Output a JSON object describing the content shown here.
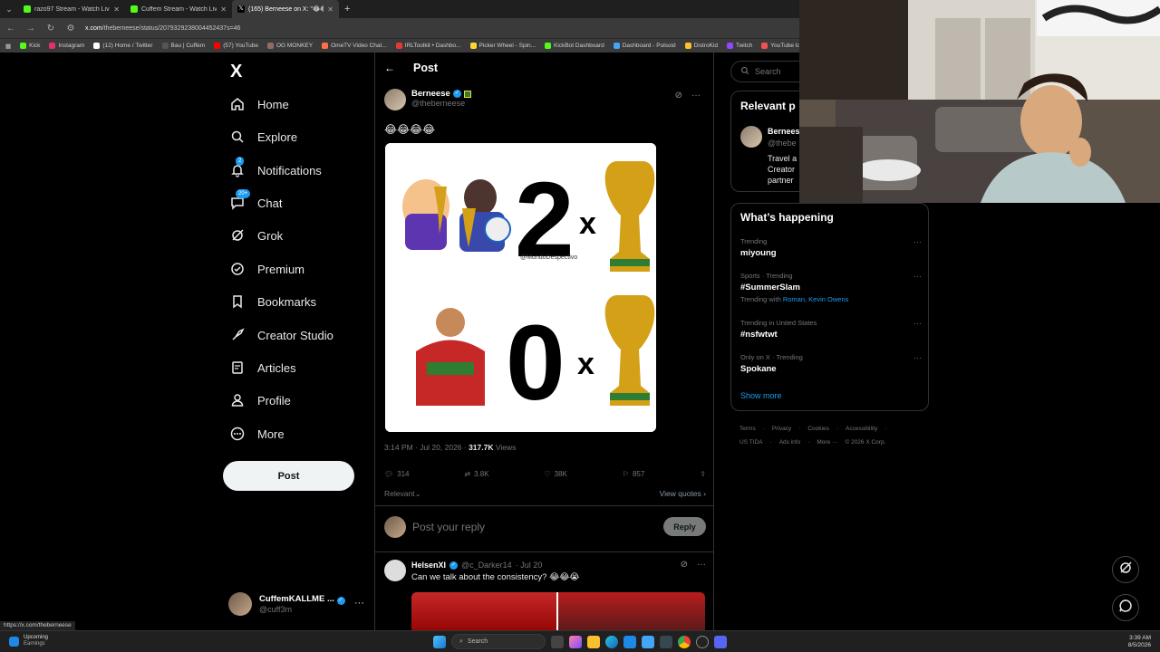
{
  "browser": {
    "tabs": [
      {
        "title": "razo97 Stream - Watch Live on",
        "color": "#53fc18",
        "active": false
      },
      {
        "title": "Cuffem Stream - Watch Live on",
        "color": "#53fc18",
        "active": false
      },
      {
        "title": "(165) Berneese on X: \"😂😂😂",
        "color": "#ffffff",
        "active": true
      }
    ],
    "new_tab": "+",
    "url_domain": "x.com",
    "url_path": "/theberneese/status/2079329238004452437s=46",
    "bookmarks": [
      "Kick",
      "Instagram",
      "(12) Home / Twitter",
      "Bau | Cuffem",
      "(57) YouTube",
      "OG MONKEY",
      "OmeTV Video Chat...",
      "IRLToolkit • Dashbo...",
      "Picker Wheel - Spin...",
      "KickBot Dashboard",
      "Dashboard - Pulsoid",
      "DistroKid",
      "Twitch",
      "YouTube to WAV D..."
    ]
  },
  "nav": {
    "logo": "X",
    "items": [
      {
        "label": "Home"
      },
      {
        "label": "Explore"
      },
      {
        "label": "Notifications",
        "badge": "2"
      },
      {
        "label": "Chat",
        "badge": "20+"
      },
      {
        "label": "Grok"
      },
      {
        "label": "Premium"
      },
      {
        "label": "Bookmarks"
      },
      {
        "label": "Creator Studio"
      },
      {
        "label": "Articles"
      },
      {
        "label": "Profile"
      },
      {
        "label": "More"
      }
    ],
    "post_button": "Post",
    "account": {
      "name": "CuffemKALLME ...",
      "handle": "@cuff3m"
    }
  },
  "post": {
    "header_title": "Post",
    "author_name": "Berneese",
    "author_handle": "@theberneese",
    "text": "😂😂😂😂",
    "image": {
      "top_count": "2",
      "bottom_count": "0",
      "x_label": "x",
      "watermark": "@MundoDespectivo"
    },
    "time": "3:14 PM · Jul 20, 2026 · ",
    "views_count": "317.7K",
    "views_label": " Views",
    "stats": {
      "replies": "314",
      "reposts": "3.8K",
      "likes": "38K",
      "bookmarks": "857"
    },
    "sort": "Relevant",
    "view_quotes": "View quotes"
  },
  "reply_box": {
    "placeholder": "Post your reply",
    "button": "Reply"
  },
  "reply": {
    "name": "HelsenXI",
    "handle": "@c_Darker14",
    "date": "· Jul 20",
    "text": "Can we talk about the consistency? 😂😂😭"
  },
  "right": {
    "search_placeholder": "Search",
    "relevant_title": "Relevant p",
    "relevant_name": "Bernees",
    "relevant_handle": "@thebe",
    "relevant_bio": "Travel a\nCreator\npartner",
    "happening_title": "What’s happening",
    "trends": [
      {
        "context": "Trending",
        "name": "miyoung",
        "with": ""
      },
      {
        "context": "Sports · Trending",
        "name": "#SummerSlam",
        "with": "Trending with "
      },
      {
        "context": "Trending in United States",
        "name": "#nsfwtwt",
        "with": ""
      },
      {
        "context": "Only on X · Trending",
        "name": "Spokane",
        "with": ""
      }
    ],
    "trend_with_names": "Roman, Kevin Owens",
    "show_more": "Show more",
    "footer_line1": [
      "Terms",
      "·",
      "Privacy",
      "·",
      "Cookies",
      "·",
      "Accessibility",
      "·"
    ],
    "footer_line2": [
      "US TIDA",
      "·",
      "Ads info",
      "·",
      "More ···",
      "© 2026 X Corp."
    ]
  },
  "status_url": "https://x.com/theberneese",
  "taskbar": {
    "weather_line1": "Upcoming",
    "weather_line2": "Earnings",
    "search": "Search",
    "time": "3:39 AM",
    "date": "8/5/2026"
  },
  "colors": {
    "accent": "#1d9bf0",
    "background": "#000000",
    "border": "#2f3336",
    "muted": "#71767b"
  }
}
